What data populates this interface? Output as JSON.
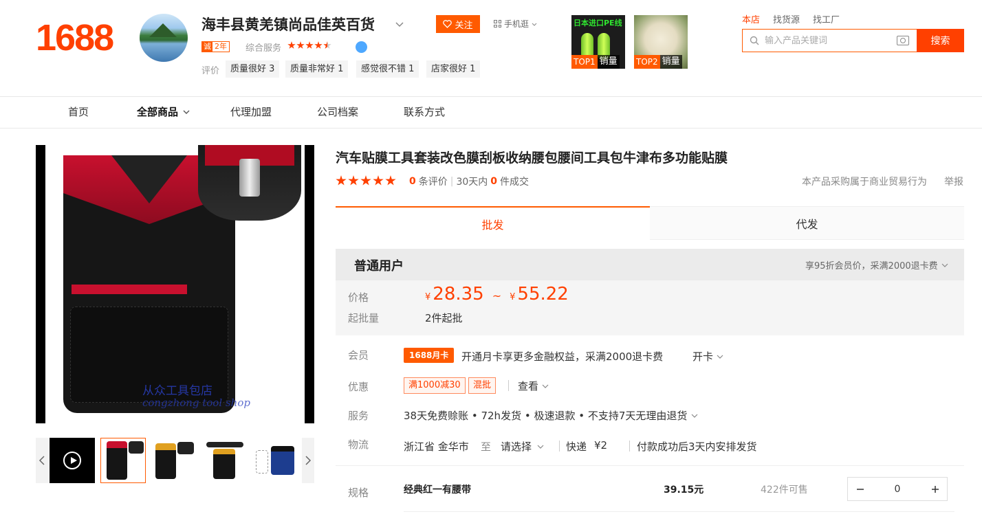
{
  "header": {
    "logo": "1688",
    "shop_name": "海丰县黄羌镇尚品佳英百货",
    "shop_years_badge": "诚",
    "shop_years": "2年",
    "service_label": "综合服务",
    "service_score": 4.5,
    "eval_label": "评价",
    "eval_tags": [
      {
        "label": "质量很好",
        "count": "3"
      },
      {
        "label": "质量非常好",
        "count": "1"
      },
      {
        "label": "感觉很不错",
        "count": "1"
      },
      {
        "label": "店家很好",
        "count": "1"
      }
    ],
    "follow_label": "关注",
    "mobile_label": "手机逛",
    "top_products": [
      {
        "title_text": "日本进口PE线",
        "rank": "TOP1",
        "sales_label": "销量"
      },
      {
        "rank": "TOP2",
        "sales_label": "销量"
      }
    ],
    "search": {
      "tabs": [
        "本店",
        "找货源",
        "找工厂"
      ],
      "active_tab": "本店",
      "placeholder": "输入产品关键词",
      "button_label": "搜索"
    }
  },
  "nav": {
    "items": [
      "首页",
      "全部商品",
      "代理加盟",
      "公司档案",
      "联系方式"
    ],
    "active": "全部商品"
  },
  "gallery": {
    "watermark_cn": "从众工具包店",
    "watermark_en": "congzhong tool shop"
  },
  "product": {
    "title": "汽车贴膜工具套装改色膜刮板收纳腰包腰间工具包牛津布多功能贴膜",
    "rating_stars": 5,
    "review_count": "0",
    "review_label": "条评价",
    "period_label": "30天内",
    "deals_count": "0",
    "deals_label": "件成交",
    "trade_note": "本产品采购属于商业贸易行为",
    "report_label": "举报",
    "tabs": [
      "批发",
      "代发"
    ],
    "active_tab": "批发",
    "user_type": "普通用户",
    "member_price_note": "享95折会员价，采满2000退卡费",
    "price_label": "价格",
    "currency": "¥",
    "price_min": "28.35",
    "price_max": "55.22",
    "tilde": "~",
    "moq_label": "起批量",
    "moq": "2件起批",
    "member_label": "会员",
    "member_badge": "1688月卡",
    "member_text": "开通月卡享更多金融权益，采满2000退卡费",
    "open_card": "开卡",
    "promo_label": "优惠",
    "promos": [
      "满1000减30",
      "混批"
    ],
    "view_label": "查看",
    "service_label": "服务",
    "service_text": "38天免费赊账 • 72h发货 • 极速退款 • 不支持7天无理由退货",
    "logistics_label": "物流",
    "origin": "浙江省 金华市",
    "to_label": "至",
    "dest_select": "请选择",
    "express": "快递",
    "shipping_fee": "¥2",
    "ship_note": "付款成功后3天内安排发货",
    "spec_label": "规格",
    "spec": {
      "name": "经典红一有腰带",
      "price": "39.15元",
      "stock": "422件可售",
      "qty": "0"
    }
  },
  "colors": {
    "brand": "#ff4000",
    "accent": "#ff5a00"
  }
}
